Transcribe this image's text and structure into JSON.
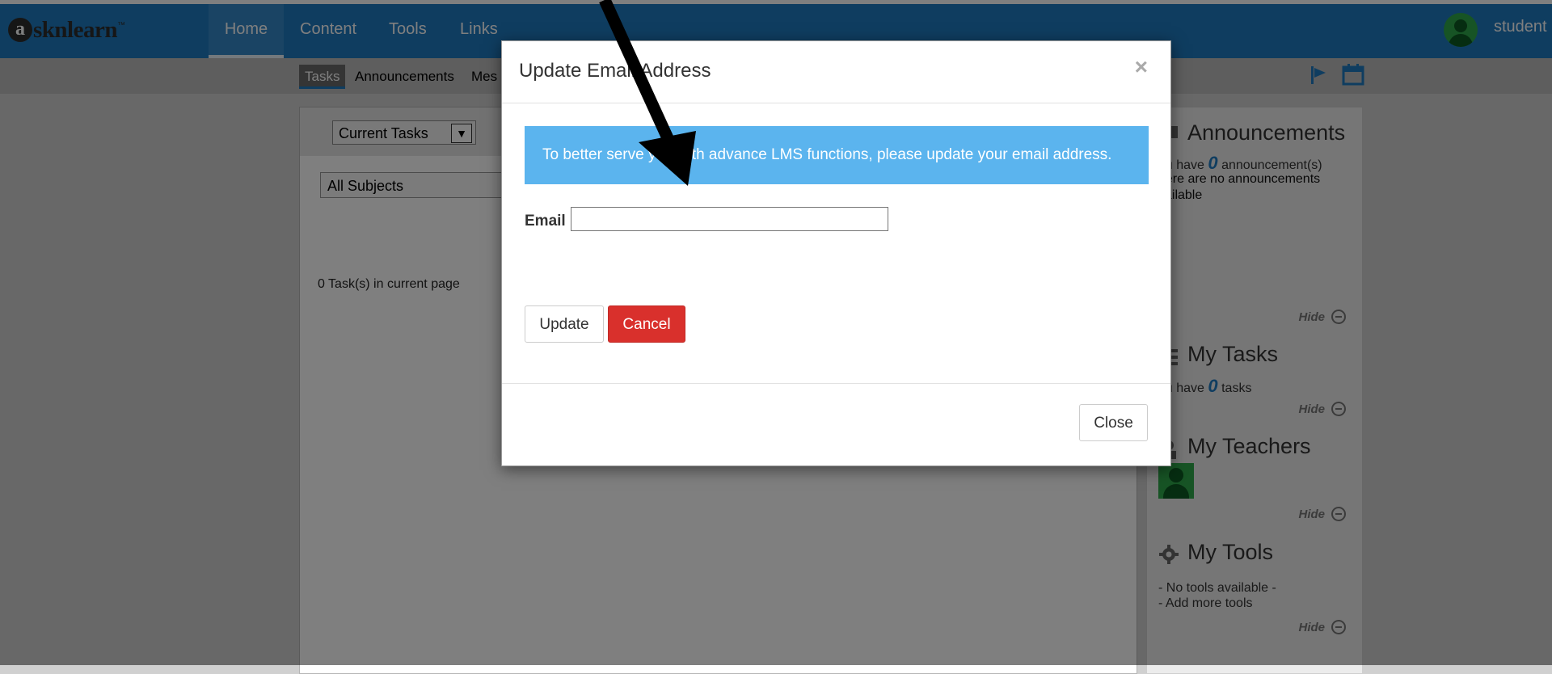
{
  "brand": {
    "logo_letter": "a",
    "logo_text": "sknlearn",
    "logo_tm": "™"
  },
  "nav": {
    "items": [
      {
        "label": "Home",
        "active": true
      },
      {
        "label": "Content"
      },
      {
        "label": "Tools"
      },
      {
        "label": "Links"
      }
    ],
    "user": {
      "name": "student"
    }
  },
  "subnav": {
    "tabs": [
      {
        "label": "Tasks",
        "active": true
      },
      {
        "label": "Announcements"
      },
      {
        "label": "Mes"
      }
    ],
    "icons": [
      "flag-icon",
      "calendar-icon"
    ]
  },
  "main": {
    "task_filter": "Current Tasks",
    "subject_filter": "All Subjects",
    "task_count": "0 Task(s) in current page"
  },
  "side": {
    "announcements": {
      "title": "Announcements",
      "count_prefix": "ou have",
      "count": "0",
      "count_suffix": "announcement(s)",
      "empty_line1": "here are no announcements",
      "empty_line2": "vailable"
    },
    "my_tasks": {
      "title": "My Tasks",
      "count_prefix": "ou have",
      "count": "0",
      "count_suffix": "tasks"
    },
    "my_teachers": {
      "title": "My Teachers"
    },
    "my_tools": {
      "title": "My Tools",
      "line1": "- No tools available -",
      "line2": "- Add more tools"
    },
    "hide_label": "Hide"
  },
  "modal": {
    "title": "Update Email Address",
    "close_glyph": "×",
    "info": "To better serve you with advance LMS functions, please update your email address.",
    "email_label": "Email",
    "email_value": "",
    "update_label": "Update",
    "cancel_label": "Cancel",
    "close_label": "Close"
  },
  "colors": {
    "nav_blue": "#1f7ac1",
    "info_blue": "#5bb4ee",
    "danger_red": "#d9302c",
    "teacher_green": "#2fa84a"
  }
}
